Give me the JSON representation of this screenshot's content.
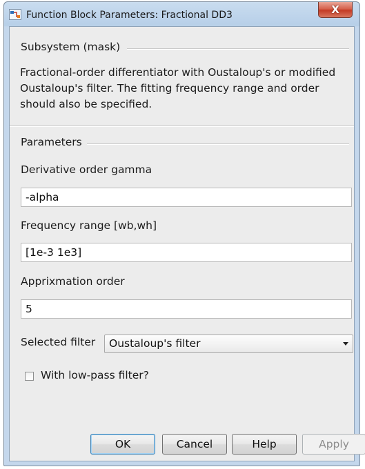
{
  "window": {
    "title": "Function Block Parameters: Fractional DD3",
    "close_label": "X"
  },
  "mask": {
    "heading": "Subsystem (mask)",
    "description": "Fractional-order differentiator with Oustaloup's or modified Oustaloup's filter.  The fitting frequency range and order should also be specified."
  },
  "parameters": {
    "heading": "Parameters",
    "gamma": {
      "label": "Derivative order gamma",
      "value": "-alpha"
    },
    "freq": {
      "label": "Frequency range [wb,wh]",
      "value": "[1e-3 1e3]"
    },
    "order": {
      "label": "Apprixmation order",
      "value": "5"
    },
    "filter": {
      "label": "Selected filter",
      "value": "Oustaloup's filter"
    },
    "lowpass": {
      "label": "With low-pass filter?",
      "checked": false
    }
  },
  "buttons": {
    "ok": "OK",
    "cancel": "Cancel",
    "help": "Help",
    "apply": "Apply"
  },
  "icons": {
    "app": "simulink-block-icon",
    "close": "close-icon",
    "dropdown": "chevron-down-icon"
  },
  "colors": {
    "close_button": "#c43b25",
    "title_bar": "#b7cfe8",
    "dialog_background": "#ececec"
  }
}
